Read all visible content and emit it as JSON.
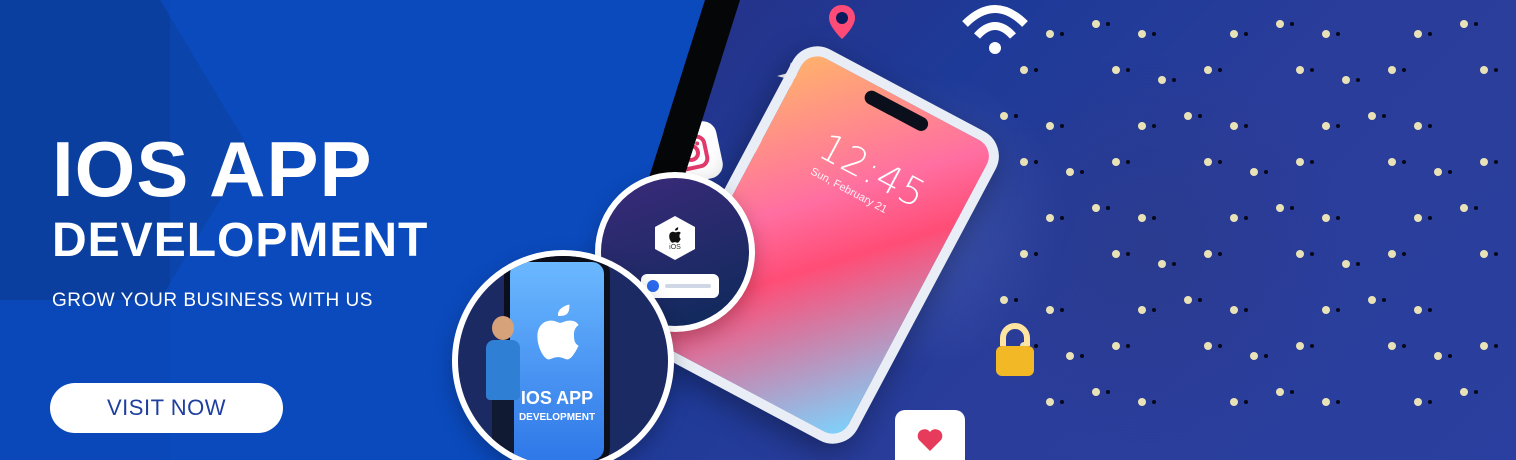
{
  "banner": {
    "title_line1": "IOS APP",
    "title_line2": "DEVELOPMENT",
    "subtitle": "GROW YOUR BUSINESS WITH US",
    "cta_label": "VISIT NOW"
  },
  "illustration": {
    "phone_time": "12:45",
    "phone_date": "Sun, February 21",
    "circle_phone_title": "IOS APP",
    "circle_phone_subtitle": "DEVELOPMENT",
    "ios_chip_label": "iOS"
  },
  "colors": {
    "primary_blue": "#0A47B8",
    "cta_text": "#1F3F9E",
    "white": "#FFFFFF"
  },
  "icons": [
    "instagram-icon",
    "location-pin-icon",
    "wifi-icon",
    "sparkle-icon",
    "apple-icon",
    "heart-icon",
    "lock-icon"
  ]
}
